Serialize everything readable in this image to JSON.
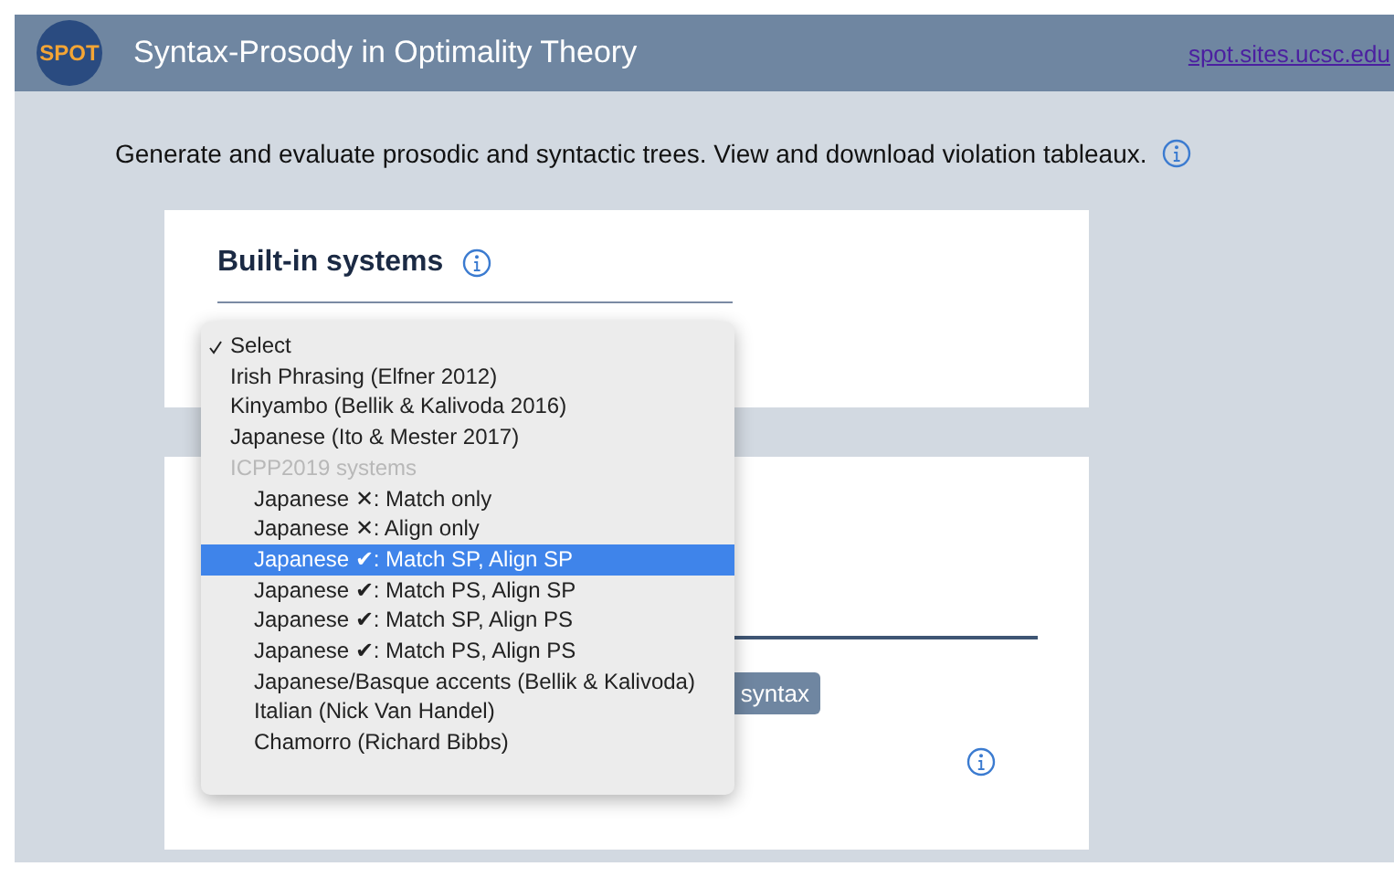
{
  "header": {
    "logo": "SPOT",
    "title": "Syntax-Prosody in Optimality Theory",
    "link": "spot.sites.ucsc.edu"
  },
  "intro": "Generate and evaluate prosodic and syntactic trees. View and download violation tableaux.",
  "builtin": {
    "heading": "Built-in systems"
  },
  "dropdown": [
    {
      "kind": "option",
      "label": "Select",
      "checked": true,
      "selected": false
    },
    {
      "kind": "option",
      "label": "Irish Phrasing (Elfner 2012)",
      "checked": false,
      "selected": false
    },
    {
      "kind": "option",
      "label": "Kinyambo (Bellik & Kalivoda 2016)",
      "checked": false,
      "selected": false
    },
    {
      "kind": "option",
      "label": "Japanese (Ito & Mester 2017)",
      "checked": false,
      "selected": false
    },
    {
      "kind": "group",
      "label": "ICPP2019 systems"
    },
    {
      "kind": "sub",
      "label": "Japanese ✕: Match only",
      "checked": false,
      "selected": false
    },
    {
      "kind": "sub",
      "label": "Japanese ✕: Align only",
      "checked": false,
      "selected": false
    },
    {
      "kind": "sub",
      "label": "Japanese ✔: Match SP, Align SP",
      "checked": false,
      "selected": true
    },
    {
      "kind": "sub",
      "label": "Japanese ✔: Match PS, Align SP",
      "checked": false,
      "selected": false
    },
    {
      "kind": "sub",
      "label": "Japanese ✔: Match SP, Align PS",
      "checked": false,
      "selected": false
    },
    {
      "kind": "sub",
      "label": "Japanese ✔: Match PS, Align PS",
      "checked": false,
      "selected": false
    },
    {
      "kind": "sub",
      "label": "Japanese/Basque accents (Bellik & Kalivoda)",
      "checked": false,
      "selected": false
    },
    {
      "kind": "sub",
      "label": "Italian (Nick Van Handel)",
      "checked": false,
      "selected": false
    },
    {
      "kind": "sub",
      "label": "Chamorro (Richard Bibbs)",
      "checked": false,
      "selected": false
    }
  ],
  "second_card": {
    "button": "syntax"
  }
}
